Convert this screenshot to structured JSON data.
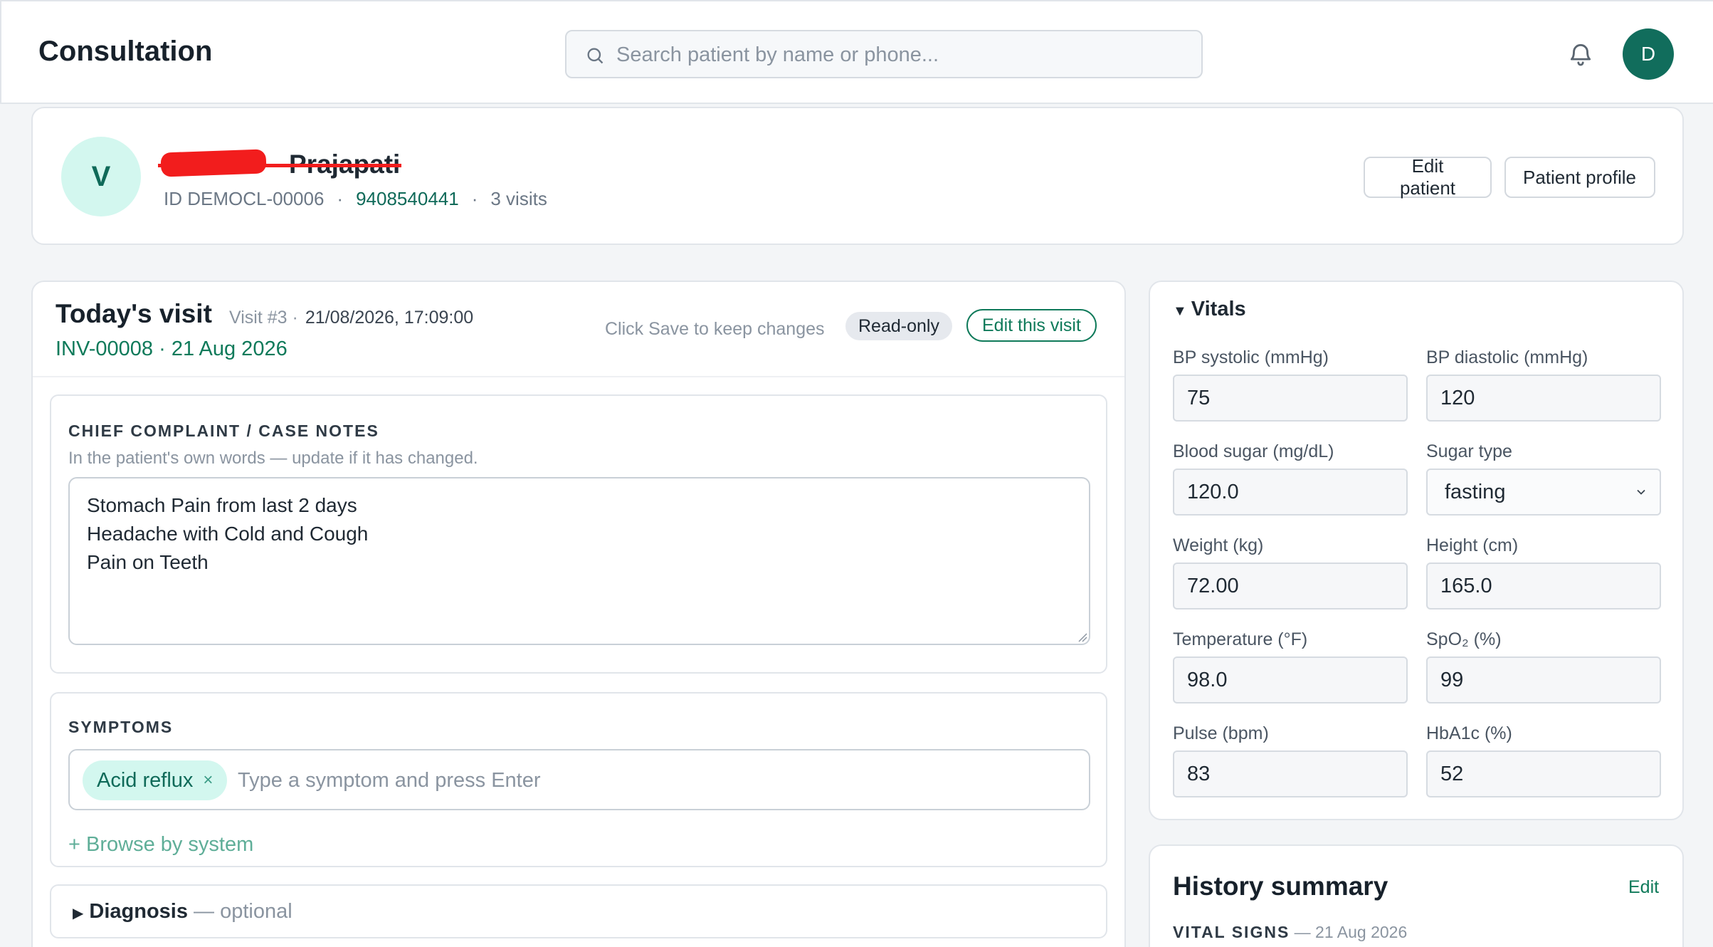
{
  "header": {
    "title": "Consultation",
    "search_placeholder": "Search patient by name or phone...",
    "avatar_initial": "D"
  },
  "patient": {
    "initial": "V",
    "name": "Prajapati",
    "id": "ID DEMOCL-00006",
    "phone": "9408540441",
    "visits": "3 visits",
    "edit_label": "Edit patient",
    "profile_label": "Patient profile"
  },
  "visit": {
    "title": "Today's visit",
    "visit_no": "Visit #3 ·",
    "datetime": "21/08/2026, 17:09:00",
    "invoice": "INV-00008 · 21 Aug 2026",
    "hint": "Click Save to keep changes",
    "readonly_label": "Read-only",
    "edit_label": "Edit this visit"
  },
  "complaint": {
    "label": "CHIEF COMPLAINT / CASE NOTES",
    "sub": "In the patient's own words — update if it has changed.",
    "notes": "Stomach Pain from last 2 days\nHeadache with Cold and Cough\nPain on Teeth"
  },
  "symptoms": {
    "label": "SYMPTOMS",
    "chips": [
      "Acid reflux"
    ],
    "placeholder": "Type a symptom and press Enter",
    "browse": "+ Browse by system"
  },
  "diagnosis": {
    "label": "Diagnosis",
    "optional": "— optional"
  },
  "vitals": {
    "title": "Vitals",
    "fields": [
      {
        "label": "BP systolic (mmHg)",
        "value": "75"
      },
      {
        "label": "BP diastolic (mmHg)",
        "value": "120"
      },
      {
        "label": "Blood sugar (mg/dL)",
        "value": "120.0"
      },
      {
        "label": "Sugar type",
        "value": "fasting"
      },
      {
        "label": "Weight (kg)",
        "value": "72.00"
      },
      {
        "label": "Height (cm)",
        "value": "165.0"
      },
      {
        "label": "Temperature (°F)",
        "value": "98.0"
      },
      {
        "label": "SpO₂ (%)",
        "value": "99"
      },
      {
        "label": "Pulse (bpm)",
        "value": "83"
      },
      {
        "label": "HbA1c (%)",
        "value": "52"
      }
    ]
  },
  "history": {
    "title": "History summary",
    "edit_label": "Edit",
    "vital_signs_label": "VITAL SIGNS",
    "vital_signs_date": "— 21 Aug 2026"
  },
  "colors": {
    "accent": "#0f7a5a",
    "avatar_bg": "#116d5c",
    "chip_bg": "#d3f7ef",
    "redaction": "#f21d1d"
  }
}
